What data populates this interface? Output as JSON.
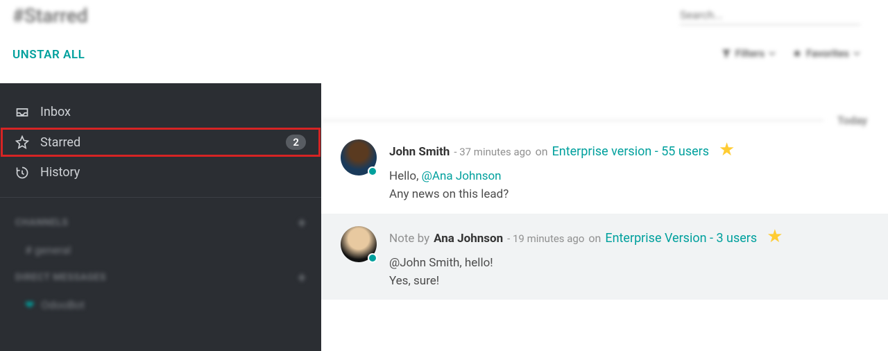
{
  "header": {
    "title": "#Starred",
    "unstar_label": "UNSTAR ALL",
    "search_placeholder": "Search...",
    "filters_label": "Filters",
    "favorites_label": "Favorites"
  },
  "sidebar": {
    "items": [
      {
        "icon": "inbox",
        "label": "Inbox",
        "badge": null,
        "active": false
      },
      {
        "icon": "star",
        "label": "Starred",
        "badge": "2",
        "active": true
      },
      {
        "icon": "history",
        "label": "History",
        "badge": null,
        "active": false
      }
    ],
    "channels_header": "CHANNELS",
    "channels": [
      {
        "label": "# general"
      }
    ],
    "dm_header": "DIRECT MESSAGES",
    "dms": [
      {
        "label": "OdooBot"
      }
    ]
  },
  "day_separator": "Today",
  "messages": [
    {
      "note_prefix": null,
      "author": "John Smith",
      "meta": "- 37 minutes ago",
      "on": "on",
      "link": "Enterprise version - 55 users",
      "greeting": "Hello, ",
      "mention": "@Ana Johnson",
      "line2": "Any news on this lead?",
      "highlight": false,
      "avatar": "a1"
    },
    {
      "note_prefix": "Note by ",
      "author": "Ana Johnson",
      "meta": "- 19 minutes ago",
      "on": "on",
      "link": "Enterprise Version - 3 users",
      "greeting": "@John Smith, hello!",
      "mention": null,
      "line2": "Yes, sure!",
      "highlight": true,
      "avatar": "a2"
    }
  ],
  "icons": {
    "star_glyph": "★"
  }
}
